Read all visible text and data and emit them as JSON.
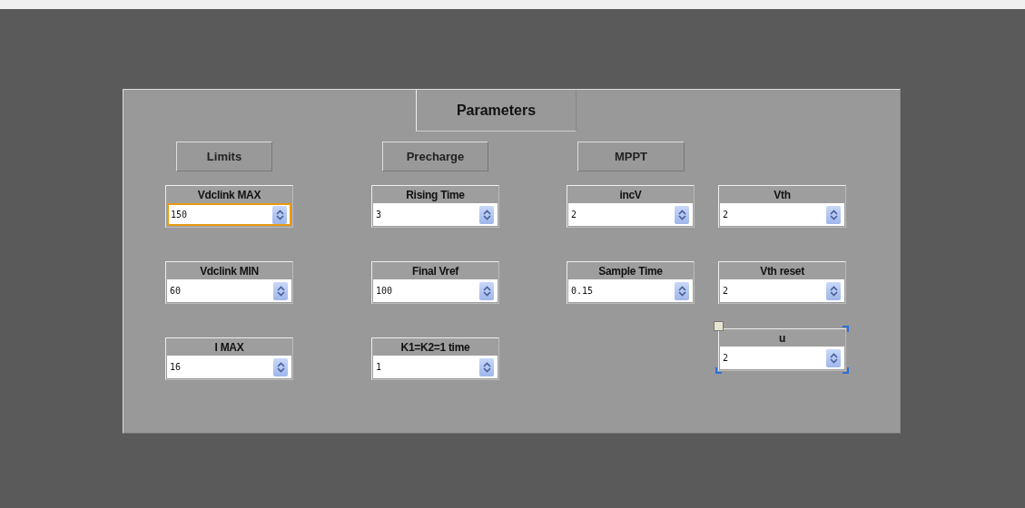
{
  "panel": {
    "title": "Parameters"
  },
  "columns": [
    {
      "header": "Limits",
      "fields": [
        {
          "label": "Vdclink MAX",
          "value": "150",
          "focused": true,
          "selected": false
        },
        {
          "label": "Vdclink MIN",
          "value": "60",
          "focused": false,
          "selected": false
        },
        {
          "label": "I MAX",
          "value": "16",
          "focused": false,
          "selected": false
        }
      ]
    },
    {
      "header": "Precharge",
      "fields": [
        {
          "label": "Rising Time",
          "value": "3",
          "focused": false,
          "selected": false
        },
        {
          "label": "Final Vref",
          "value": "100",
          "focused": false,
          "selected": false
        },
        {
          "label": "K1=K2=1 time",
          "value": "1",
          "focused": false,
          "selected": false
        }
      ]
    },
    {
      "header": "MPPT",
      "fields": [
        {
          "label": "incV",
          "value": "2",
          "focused": false,
          "selected": false
        },
        {
          "label": "Sample Time",
          "value": "0.15",
          "focused": false,
          "selected": false
        }
      ]
    },
    {
      "fields": [
        {
          "label": "Vth",
          "value": "2",
          "focused": false,
          "selected": false
        },
        {
          "label": "Vth reset",
          "value": "2",
          "focused": false,
          "selected": false
        },
        {
          "label": "u",
          "value": "2",
          "focused": false,
          "selected": true
        }
      ]
    }
  ]
}
